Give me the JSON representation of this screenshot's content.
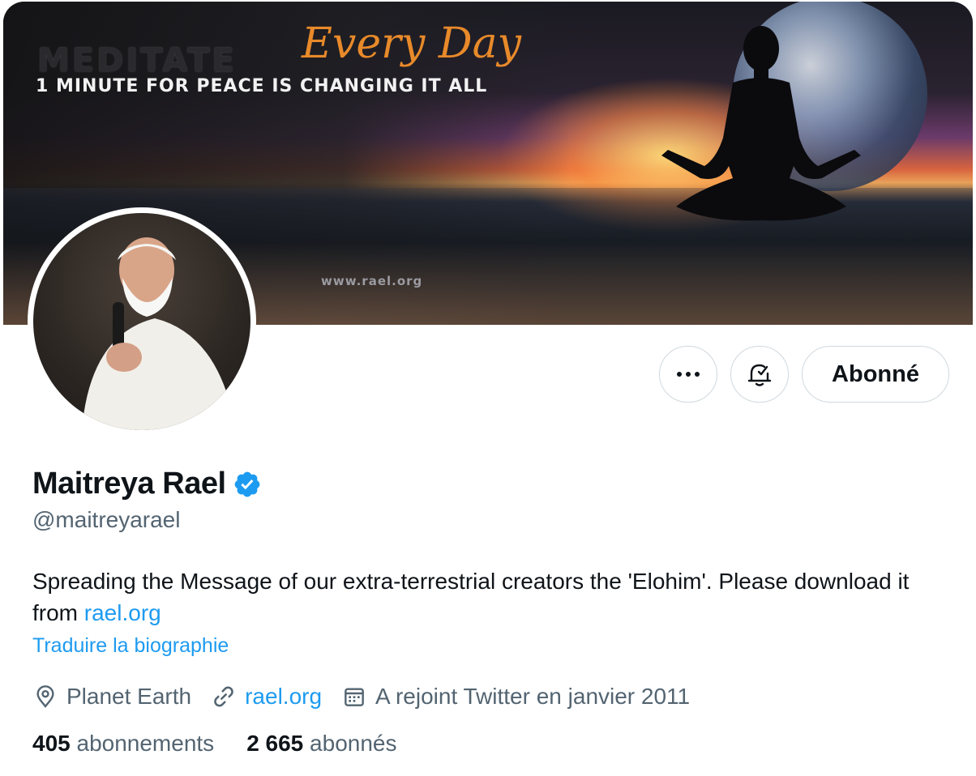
{
  "banner": {
    "headline_line1": "MEDITATE",
    "headline_script": "Every Day",
    "headline_line2": "1 MINUTE FOR PEACE IS CHANGING IT ALL",
    "watermark_url": "www.rael.org"
  },
  "actions": {
    "more_label": "•••",
    "bell_icon": "bell-check-icon",
    "follow_label": "Abonné"
  },
  "profile": {
    "name": "Maitreya Rael",
    "verified_icon": "verified-badge-icon",
    "handle": "@maitreyarael",
    "bio_text": "Spreading the Message of our extra-terrestrial creators the 'Elohim'. Please download it from ",
    "bio_link": "rael.org",
    "translate_label": "Traduire la biographie"
  },
  "meta": {
    "location": "Planet Earth",
    "website": "rael.org",
    "joined": "A rejoint Twitter en janvier 2011"
  },
  "stats": {
    "following_count": "405",
    "following_label": "abonnements",
    "followers_count": "2 665",
    "followers_label": "abonnés"
  },
  "colors": {
    "accent": "#1d9bf0",
    "text": "#0f1419",
    "secondary": "#536471",
    "border": "#cfd9de"
  }
}
